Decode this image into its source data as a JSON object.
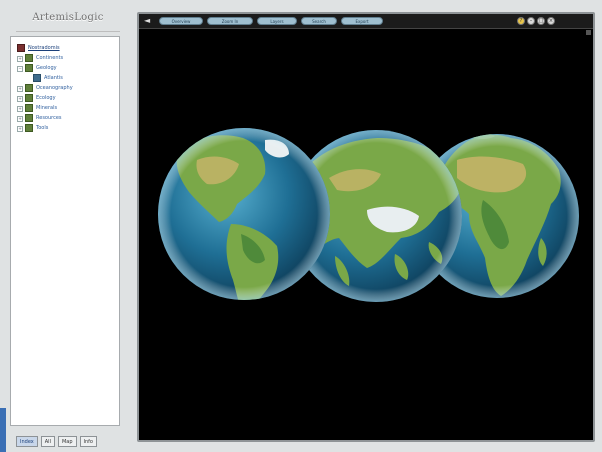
{
  "app": {
    "logo_text": "ArtemisLogic"
  },
  "tree": {
    "items": [
      {
        "label": "Nostradomis",
        "icon": "book-icon",
        "level": 0,
        "expander": "",
        "root": true
      },
      {
        "label": "Continents",
        "icon": "folder-icon",
        "level": 1,
        "expander": "+"
      },
      {
        "label": "Geology",
        "icon": "folder-icon",
        "level": 1,
        "expander": "−"
      },
      {
        "label": "Atlantis",
        "icon": "page-icon",
        "level": 2,
        "expander": ""
      },
      {
        "label": "Oceanography",
        "icon": "folder-icon",
        "level": 1,
        "expander": "+"
      },
      {
        "label": "Ecology",
        "icon": "folder-icon",
        "level": 1,
        "expander": "+"
      },
      {
        "label": "Minerals",
        "icon": "folder-icon",
        "level": 1,
        "expander": "+"
      },
      {
        "label": "Resources",
        "icon": "folder-icon",
        "level": 1,
        "expander": "+"
      },
      {
        "label": "Tools",
        "icon": "folder-icon",
        "level": 1,
        "expander": "+"
      }
    ]
  },
  "tabs": [
    {
      "label": "Index",
      "active": true
    },
    {
      "label": "All",
      "active": false
    },
    {
      "label": "Map",
      "active": false
    },
    {
      "label": "Info",
      "active": false
    }
  ],
  "viewer": {
    "back_glyph": "◄",
    "toolbar_buttons": [
      "Overview",
      "Zoom In",
      "Layers",
      "Search",
      "Export"
    ],
    "window_controls": {
      "help": "?",
      "min": "–",
      "max": "□",
      "close": "×"
    }
  },
  "colors": {
    "viewer_bg": "#000000",
    "ocean": "#1f6f95",
    "land": "#7aa848",
    "desert": "#c9b46a",
    "ice": "#e8eef0",
    "accent": "#3a6fb5"
  }
}
